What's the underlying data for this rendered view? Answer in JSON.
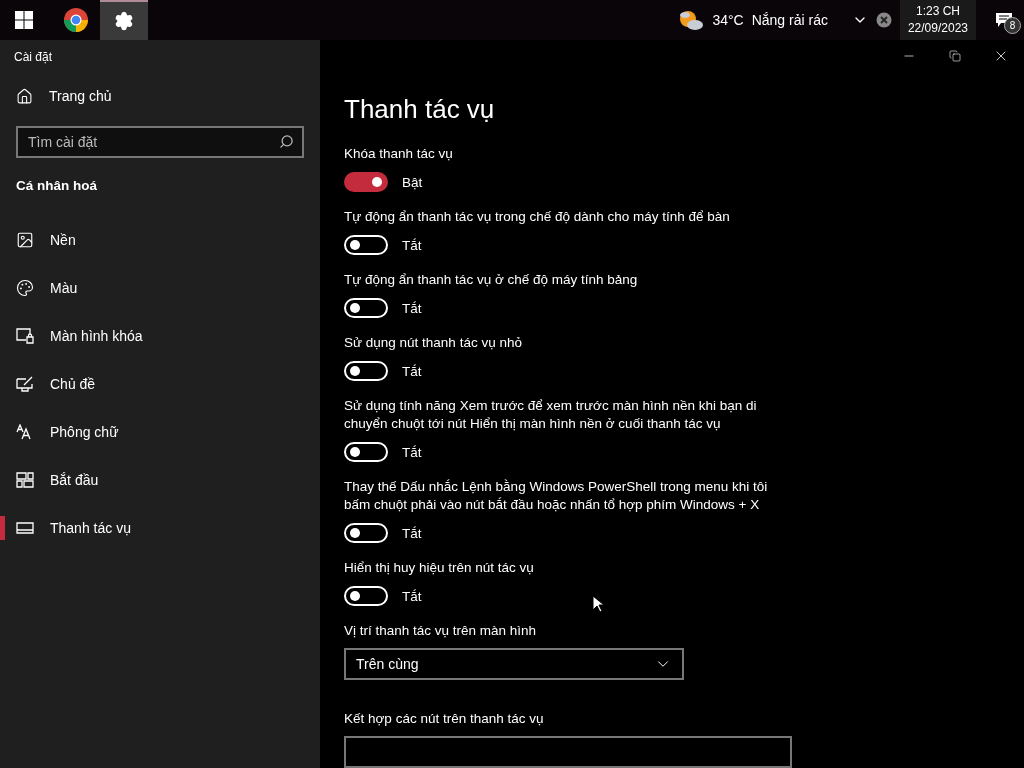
{
  "taskbar": {
    "weather": {
      "temperature": "34°C",
      "condition": "Nắng rải rác"
    },
    "clock": {
      "time": "1:23 CH",
      "date": "22/09/2023"
    },
    "notification_count": "8"
  },
  "window": {
    "title": "Cài đặt"
  },
  "sidebar": {
    "home": "Trang chủ",
    "search": {
      "placeholder": "Tìm cài đặt"
    },
    "section": "Cá nhân hoá",
    "items": [
      {
        "label": "Nền",
        "selected": false
      },
      {
        "label": "Màu",
        "selected": false
      },
      {
        "label": "Màn hình khóa",
        "selected": false
      },
      {
        "label": "Chủ đề",
        "selected": false
      },
      {
        "label": "Phông chữ",
        "selected": false
      },
      {
        "label": "Bắt đầu",
        "selected": false
      },
      {
        "label": "Thanh tác vụ",
        "selected": true
      }
    ]
  },
  "page": {
    "title": "Thanh tác vụ",
    "settings": [
      {
        "label": "Khóa thanh tác vụ",
        "on": true,
        "state": "Bật"
      },
      {
        "label": "Tự động ẩn thanh tác vụ trong chế độ dành cho máy tính để bàn",
        "on": false,
        "state": "Tắt"
      },
      {
        "label": "Tự động ẩn thanh tác vụ ở chế độ máy tính bảng",
        "on": false,
        "state": "Tắt"
      },
      {
        "label": "Sử dụng nút thanh tác vụ nhỏ",
        "on": false,
        "state": "Tắt"
      },
      {
        "label": "Sử dụng tính năng Xem trước để xem trước màn hình nền khi bạn di chuyển chuột tới nút Hiển thị màn hình nền ở cuối thanh tác vụ",
        "on": false,
        "state": "Tắt"
      },
      {
        "label": "Thay thế Dấu nhắc Lệnh bằng Windows PowerShell trong menu khi tôi bấm chuột phải vào nút bắt đầu hoặc nhấn tổ hợp phím Windows + X",
        "on": false,
        "state": "Tắt"
      },
      {
        "label": "Hiển thị huy hiệu trên nút tác vụ",
        "on": false,
        "state": "Tắt"
      }
    ],
    "position": {
      "label": "Vị trí thanh tác vụ trên màn hình",
      "value": "Trên cùng"
    },
    "combine": {
      "label": "Kết hợp các nút trên thanh tác vụ"
    }
  }
}
